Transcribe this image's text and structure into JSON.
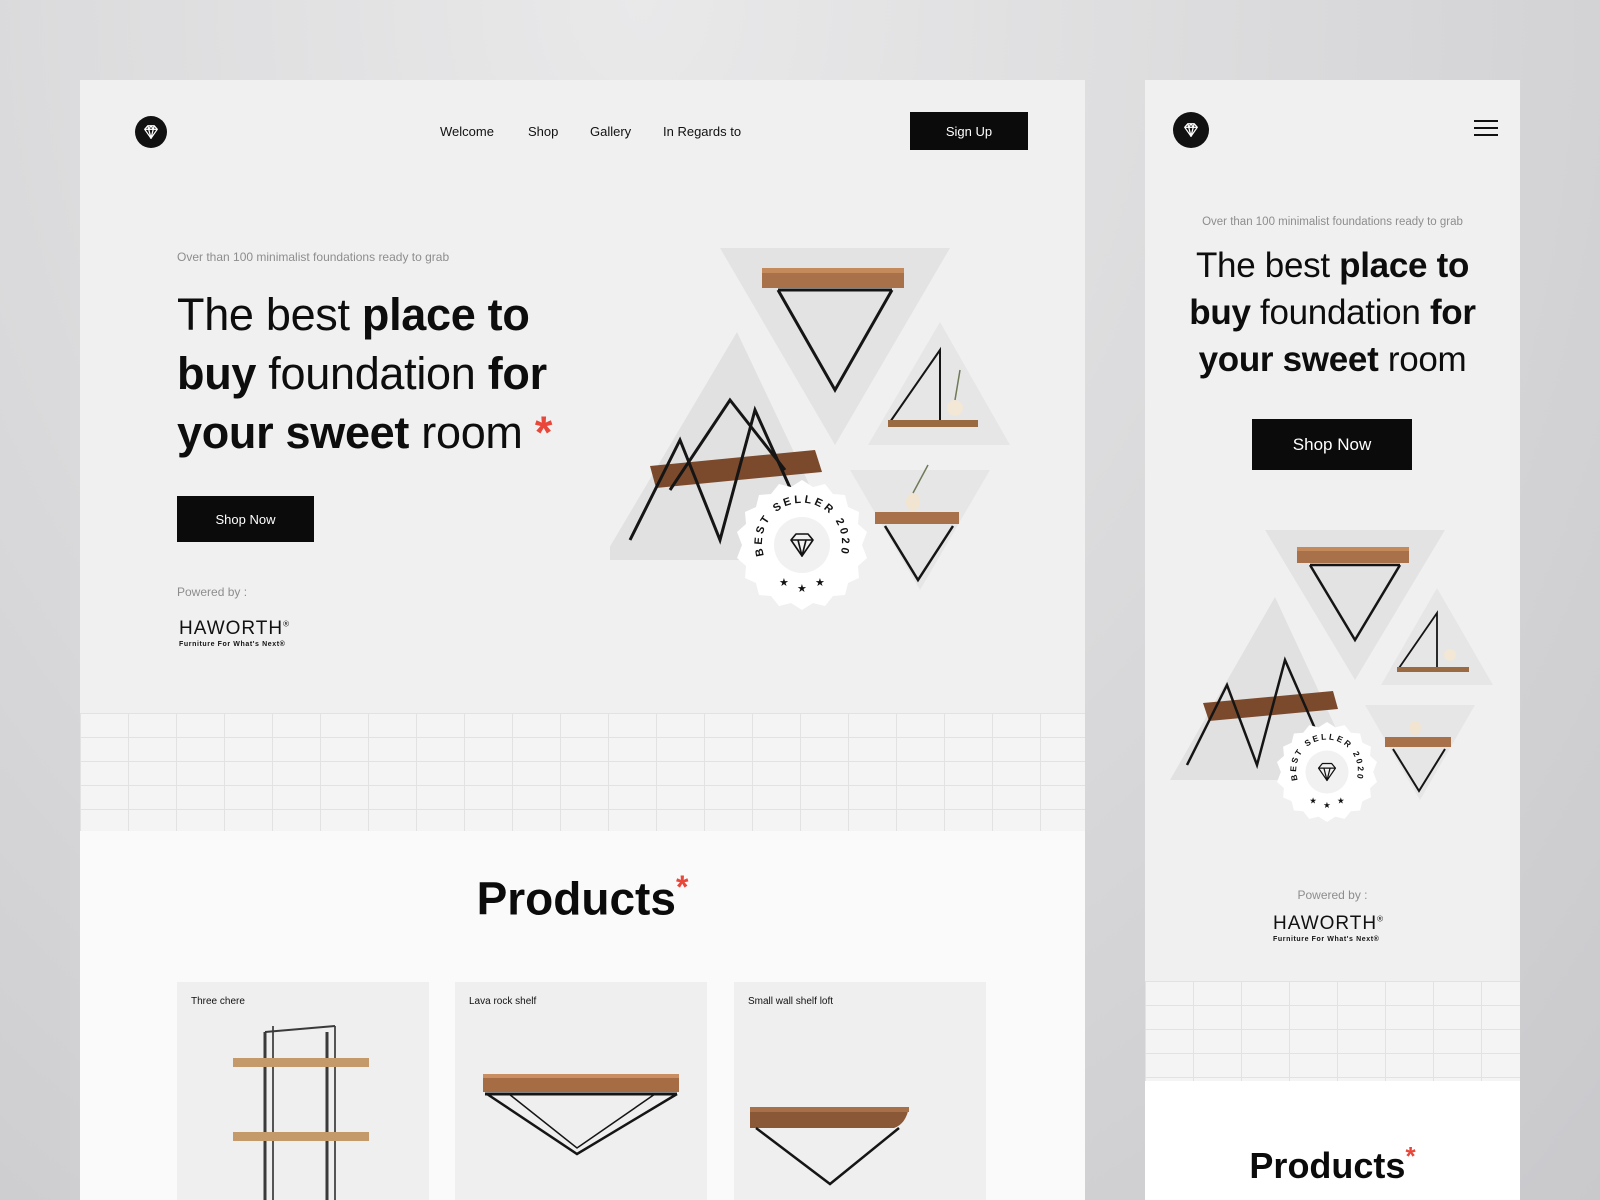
{
  "colors": {
    "accent": "#e8473a",
    "dark": "#0b0b0b",
    "hero_bg": "#f0f0f0"
  },
  "desktop": {
    "nav": [
      "Welcome",
      "Shop",
      "Gallery",
      "In Regards to"
    ],
    "signup_label": "Sign Up",
    "eyebrow": "Over than 100 minimalist foundations ready to grab",
    "headline": {
      "l1a": "The best ",
      "l1b": "place to",
      "l2a": "buy",
      "l2b": " foundation ",
      "l2c": "for",
      "l3a": "your sweet",
      "l3b": " room ",
      "asterisk": "*"
    },
    "shop_now_label": "Shop Now",
    "powered_by": "Powered by :",
    "brand": {
      "name": "HAWORTH",
      "reg": "®",
      "tagline": "Furniture For What's Next®"
    },
    "badge": {
      "ring_text": "BEST SELLER 2020"
    },
    "products_title": "Products",
    "products_asterisk": "*",
    "products": [
      {
        "name": "Three chere"
      },
      {
        "name": "Lava rock shelf"
      },
      {
        "name": "Small wall shelf loft"
      }
    ]
  },
  "mobile": {
    "eyebrow": "Over than 100 minimalist foundations ready to grab",
    "headline": {
      "l1a": "The best ",
      "l1b": "place to",
      "l2a": "buy",
      "l2b": " foundation ",
      "l2c": "for",
      "l3a": "your sweet",
      "l3b": " room"
    },
    "shop_now_label": "Shop Now",
    "powered_by": "Powered by :",
    "brand": {
      "name": "HAWORTH",
      "reg": "®",
      "tagline": "Furniture For What's Next®"
    },
    "badge": {
      "ring_text": "BEST SELLER 2020"
    },
    "products_title": "Products",
    "products_asterisk": "*"
  }
}
